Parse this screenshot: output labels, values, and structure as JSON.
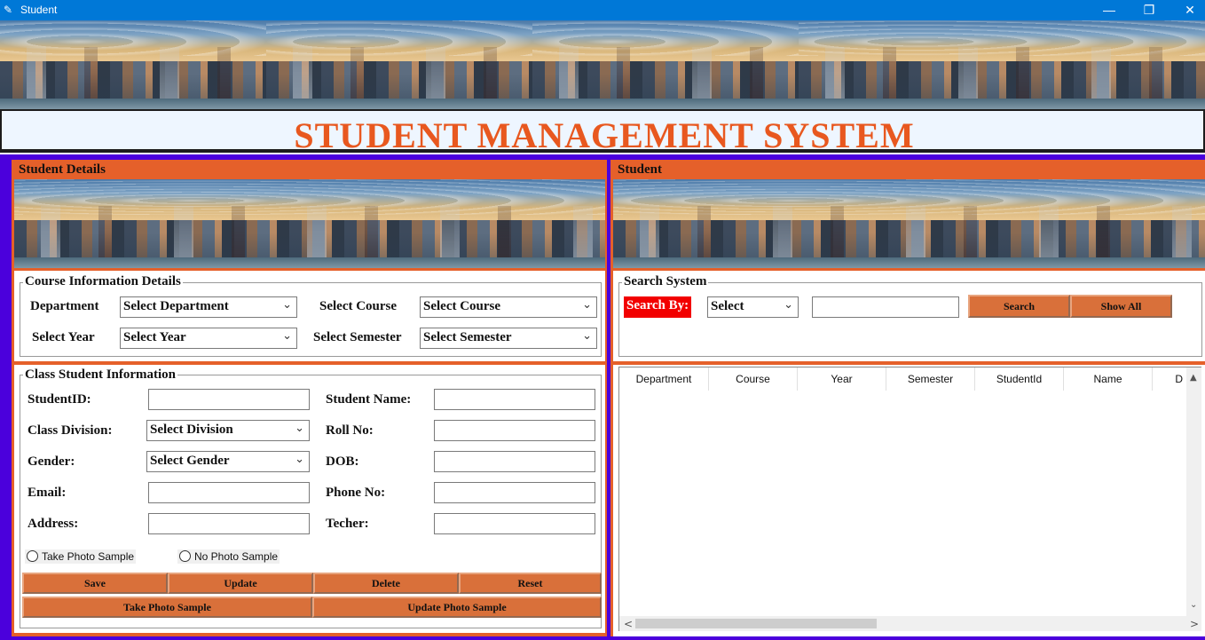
{
  "window": {
    "title": "Student",
    "minimize": "—",
    "restore": "❐",
    "close": "✕",
    "icon": "feather-icon"
  },
  "header": {
    "title": "STUDENT MANAGEMENT SYSTEM"
  },
  "left": {
    "legend": "Student Details",
    "course": {
      "legend": "Course Information Details",
      "department_label": "Department",
      "department_value": "Select Department",
      "course_label": "Select Course",
      "course_value": "Select Course",
      "year_label": "Select Year",
      "year_value": "Select Year",
      "semester_label": "Select Semester",
      "semester_value": "Select Semester"
    },
    "student": {
      "legend": "Class Student Information",
      "studentid_label": "StudentID:",
      "name_label": "Student Name:",
      "division_label": "Class Division:",
      "division_value": "Select Division",
      "roll_label": "Roll No:",
      "gender_label": "Gender:",
      "gender_value": "Select Gender",
      "dob_label": "DOB:",
      "email_label": "Email:",
      "phone_label": "Phone No:",
      "address_label": "Address:",
      "teacher_label": "Techer:",
      "radio_take": "Take Photo Sample",
      "radio_no": "No Photo Sample"
    },
    "buttons": {
      "save": "Save",
      "update": "Update",
      "delete": "Delete",
      "reset": "Reset",
      "take_photo": "Take Photo Sample",
      "update_photo": "Update Photo Sample"
    }
  },
  "right": {
    "legend": "Student",
    "search": {
      "legend": "Search System",
      "search_by": "Search By:",
      "select_value": "Select",
      "search_button": "Search",
      "show_all_button": "Show All"
    },
    "table": {
      "columns": [
        "Department",
        "Course",
        "Year",
        "Semester",
        "StudentId",
        "Name",
        "D"
      ]
    }
  },
  "icons": {
    "dropdown": "⌄",
    "scroll_up": "▲",
    "scroll_down": "⌄",
    "scroll_left": "<",
    "scroll_right": ">"
  }
}
